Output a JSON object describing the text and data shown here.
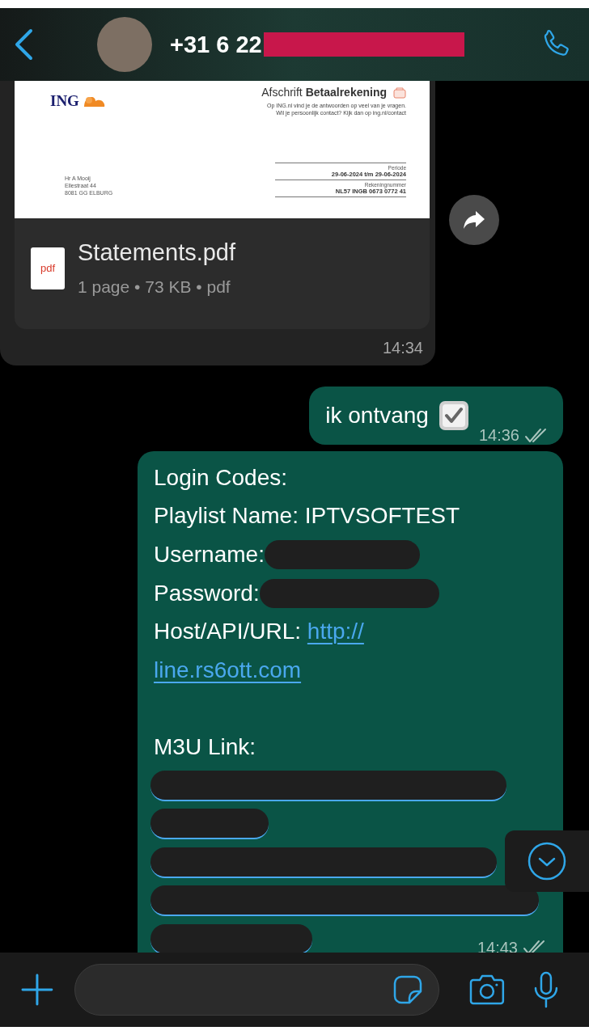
{
  "header": {
    "contact": "+31 6 22",
    "redacted": true
  },
  "messages": [
    {
      "kind": "document",
      "sent": false,
      "preview": {
        "bank": "ING",
        "title": "Afschrift **Betaalrekening**",
        "info": [
          "Op ING.nl vind je de antwoorden op veel van je vragen.",
          "Wil je persoonlijk contact? Kijk dan op ing.nl/contact"
        ],
        "address": [
          "Hr A Mooij",
          "Ellestraat 44",
          "8081 GG ELBURG"
        ],
        "fields": [
          {
            "label": "Periode",
            "value": "29-06-2024 t/m 29-06-2024"
          },
          {
            "label": "Rekeningnummer",
            "value": "NL57 INGB 0673 0772 41"
          }
        ]
      },
      "file_type": "pdf",
      "file_name": "Statements.pdf",
      "meta": "1 page • 73 KB • pdf",
      "time": "14:34"
    },
    {
      "kind": "text",
      "sent": true,
      "lines": [
        {
          "kind": "check",
          "text": "ik ontvang"
        }
      ],
      "time": "14:36",
      "read": false
    },
    {
      "kind": "text",
      "sent": true,
      "lines": [
        {
          "kind": "plain",
          "text": "Login Codes:"
        },
        {
          "kind": "plain",
          "text": "Playlist Name: IPTVSOFTEST"
        },
        {
          "kind": "redacted",
          "text": "Username:"
        },
        {
          "kind": "redacted",
          "text": "Password:"
        },
        {
          "kind": "link",
          "text": "Host/API/URL:",
          "link": "http://"
        },
        {
          "kind": "link",
          "link": "line.rs6ott.com"
        },
        {
          "kind": "blank"
        },
        {
          "kind": "plain",
          "text": "M3U Link:"
        },
        {
          "kind": "redacted-link"
        },
        {
          "kind": "redacted-link"
        },
        {
          "kind": "redacted-link"
        },
        {
          "kind": "redacted-link"
        },
        {
          "kind": "redacted-link"
        }
      ],
      "time": "14:43",
      "read": false
    }
  ]
}
